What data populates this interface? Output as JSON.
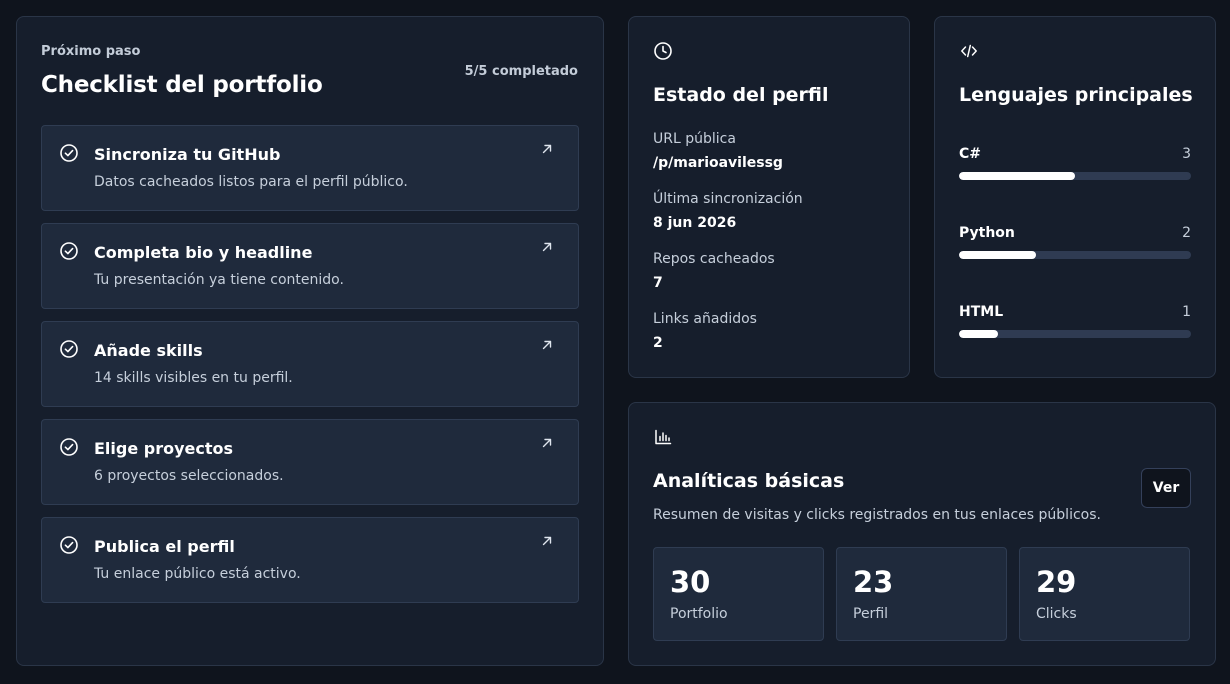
{
  "checklist": {
    "eyebrow": "Próximo paso",
    "title": "Checklist del portfolio",
    "progress": "5/5 completado",
    "tasks": [
      {
        "title": "Sincroniza tu GitHub",
        "description": "Datos cacheados listos para el perfil público.",
        "done": true
      },
      {
        "title": "Completa bio y headline",
        "description": "Tu presentación ya tiene contenido.",
        "done": true
      },
      {
        "title": "Añade skills",
        "description": "14 skills visibles en tu perfil.",
        "done": true
      },
      {
        "title": "Elige proyectos",
        "description": "6 proyectos seleccionados.",
        "done": true
      },
      {
        "title": "Publica el perfil",
        "description": "Tu enlace público está activo.",
        "done": true
      }
    ]
  },
  "status": {
    "icon": "clock-icon",
    "title": "Estado del perfil",
    "items": [
      {
        "label": "URL pública",
        "value": "/p/marioavilessg"
      },
      {
        "label": "Última sincronización",
        "value": "8 jun 2026"
      },
      {
        "label": "Repos cacheados",
        "value": "7"
      },
      {
        "label": "Links añadidos",
        "value": "2"
      }
    ]
  },
  "languages": {
    "icon": "code-icon",
    "title": "Lenguajes principales",
    "items": [
      {
        "name": "C#",
        "count": "3",
        "share": 0.5
      },
      {
        "name": "Python",
        "count": "2",
        "share": 0.33
      },
      {
        "name": "HTML",
        "count": "1",
        "share": 0.17
      }
    ]
  },
  "analytics": {
    "icon": "bar-chart-icon",
    "title": "Analíticas básicas",
    "subtitle": "Resumen de visitas y clicks registrados en tus enlaces públicos.",
    "button_label": "Ver",
    "metrics": [
      {
        "value": "30",
        "label": "Portfolio"
      },
      {
        "value": "23",
        "label": "Perfil"
      },
      {
        "value": "29",
        "label": "Clicks"
      }
    ]
  },
  "colors": {
    "background": "#0f141d",
    "card": "#161e2c",
    "item": "#1f2a3c",
    "border": "#2a3547",
    "text": "#ffffff",
    "muted": "#c6cfdb",
    "bar_track": "#2f3b52"
  }
}
